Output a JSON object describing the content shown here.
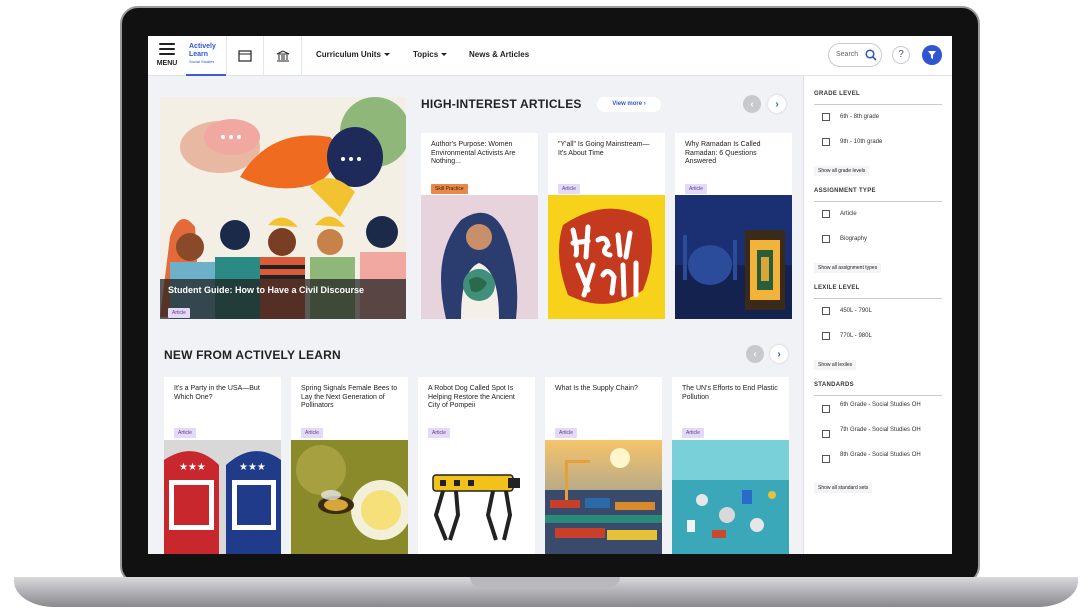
{
  "nav": {
    "menu_label": "MENU",
    "brand_line1": "Actively",
    "brand_line2": "Learn",
    "brand_sub": "Social Studies",
    "links": [
      {
        "label": "Curriculum Units"
      },
      {
        "label": "Topics"
      },
      {
        "label": "News & Articles"
      }
    ],
    "search_placeholder": "Search",
    "help_label": "?"
  },
  "hero": {
    "title": "Student Guide: How to Have a Civil Discourse",
    "tag": "Article"
  },
  "high_interest": {
    "title": "HIGH-INTEREST ARTICLES",
    "view_more": "View more",
    "cards": [
      {
        "title": "Author's Purpose: Women Environmental Activists Are Nothing...",
        "tag": "Skill Practice"
      },
      {
        "title": "\"Y'all\" Is Going Mainstream—It's About Time",
        "tag": "Article"
      },
      {
        "title": "Why Ramadan Is Called Ramadan: 6 Questions Answered",
        "tag": "Article"
      }
    ]
  },
  "new_from": {
    "title": "NEW FROM ACTIVELY LEARN",
    "cards": [
      {
        "title": "It's a Party in the USA—But Which One?",
        "tag": "Article"
      },
      {
        "title": "Spring Signals Female Bees to Lay the Next Generation of Pollinators",
        "tag": "Article"
      },
      {
        "title": "A Robot Dog Called Spot Is Helping Restore the Ancient City of Pompeii",
        "tag": "Article"
      },
      {
        "title": "What Is the Supply Chain?",
        "tag": "Article"
      },
      {
        "title": "The UN's Efforts to End Plastic Pollution",
        "tag": "Article"
      }
    ]
  },
  "sidebar": {
    "grade": {
      "heading": "GRADE LEVEL",
      "options": [
        "6th - 8th grade",
        "9th - 10th grade"
      ],
      "link": "Show all grade levels"
    },
    "assignment": {
      "heading": "ASSIGNMENT TYPE",
      "options": [
        "Article",
        "Biography"
      ],
      "link": "Show all assignment types"
    },
    "lexile": {
      "heading": "LEXILE LEVEL",
      "options": [
        "450L - 790L",
        "770L - 980L"
      ],
      "link": "Show all lexiles"
    },
    "standards": {
      "heading": "STANDARDS",
      "options": [
        "6th Grade - Social Studies OH",
        "7th Grade - Social Studies OH",
        "8th Grade - Social Studies OH"
      ],
      "link": "Show all standard sets"
    }
  },
  "colors": {
    "accent": "#2f55d4",
    "tag_bg": "#e4d9f7",
    "skill_tag_bg": "#e8894b"
  },
  "icons": [
    "menu-icon",
    "folder-icon",
    "museum-icon",
    "search-icon",
    "help-icon",
    "filter-icon",
    "chevron-left-icon",
    "chevron-right-icon"
  ]
}
